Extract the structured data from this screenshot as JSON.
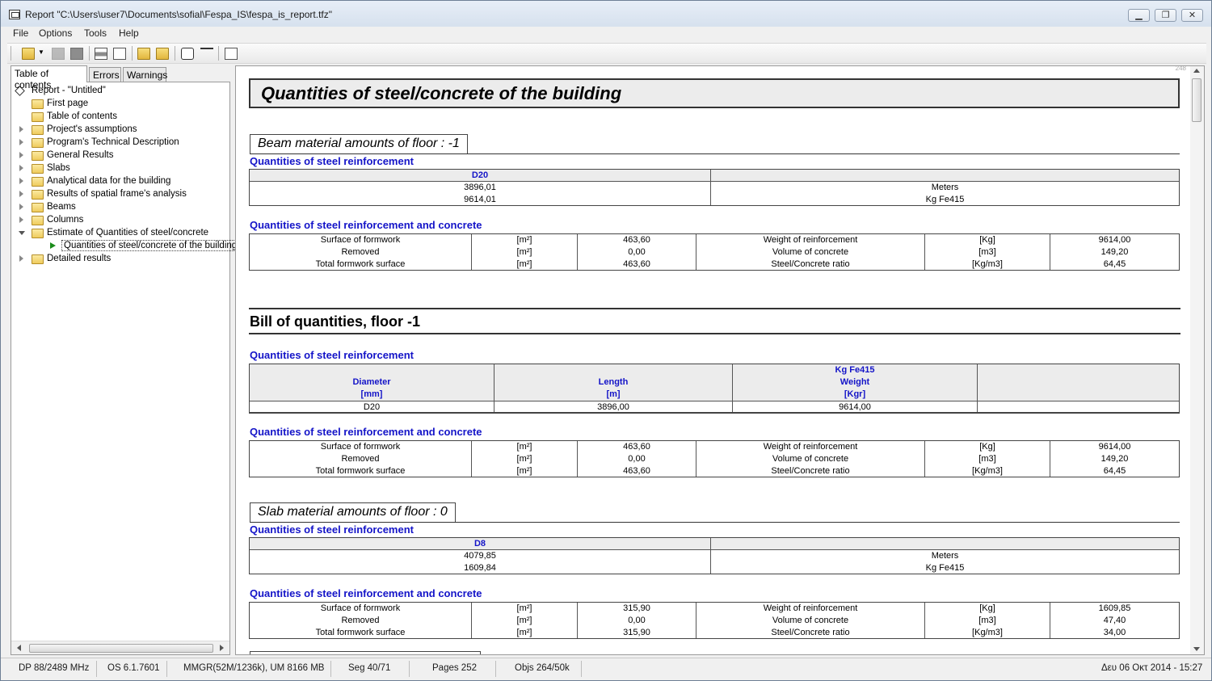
{
  "window": {
    "title": "Report \"C:\\Users\\user7\\Documents\\sofial\\Fespa_IS\\fespa_is_report.tfz\""
  },
  "menu": [
    "File",
    "Options",
    "Tools",
    "Help"
  ],
  "toolbar_icons": [
    "open-folder-icon",
    "dropdown-icon",
    "export-icon",
    "stop-icon",
    "print-icon",
    "print-preview-icon",
    "folder-up-icon",
    "folder-open-icon",
    "find-icon",
    "filter-icon",
    "page-setup-icon"
  ],
  "tabs": [
    "Table of contents",
    "Errors",
    "Warnings"
  ],
  "tree": {
    "root": "Report - \"Untitled\"",
    "items": [
      "First page",
      "Table of contents",
      "Project's assumptions",
      "Program's Technical Description",
      "General Results",
      "Slabs",
      "Analytical data for the building",
      "Results of spatial frame's analysis",
      "Beams",
      "Columns",
      "Estimate of Quantities of steel/concrete",
      "Detailed results"
    ],
    "selected_child": "Quantities of steel/concrete of the building"
  },
  "report": {
    "page_marker": "248",
    "main_heading": "Quantities of steel/concrete of the building",
    "beam_section": {
      "box_title": "Beam material amounts of floor : -1",
      "steel_title": "Quantities of steel reinforcement",
      "steel_header": "D20",
      "steel_values": [
        "3896,01",
        "9614,01"
      ],
      "steel_units": [
        "Meters",
        "Kg Fe415"
      ],
      "concrete_title": "Quantities of steel reinforcement and concrete",
      "concrete_rows": [
        [
          "Surface of formwork",
          "[m²]",
          "463,60",
          "Weight of reinforcement",
          "[Kg]",
          "9614,00"
        ],
        [
          "Removed",
          "[m²]",
          "0,00",
          "Volume of concrete",
          "[m3]",
          "149,20"
        ],
        [
          "Total formwork surface",
          "[m²]",
          "463,60",
          "Steel/Concrete ratio",
          "[Kg/m3]",
          "64,45"
        ]
      ]
    },
    "bill_section": {
      "title": "Bill of quantities, floor -1",
      "steel_title": "Quantities of steel reinforcement",
      "headers": [
        [
          "Diameter",
          "[mm]"
        ],
        [
          "Length",
          "[m]"
        ],
        [
          "Kg Fe415",
          "Weight",
          "[Kgr]"
        ]
      ],
      "row": [
        "D20",
        "3896,00",
        "9614,00"
      ],
      "concrete_title": "Quantities of steel reinforcement and concrete",
      "concrete_rows": [
        [
          "Surface of formwork",
          "[m²]",
          "463,60",
          "Weight of reinforcement",
          "[Kg]",
          "9614,00"
        ],
        [
          "Removed",
          "[m²]",
          "0,00",
          "Volume of concrete",
          "[m3]",
          "149,20"
        ],
        [
          "Total formwork surface",
          "[m²]",
          "463,60",
          "Steel/Concrete ratio",
          "[Kg/m3]",
          "64,45"
        ]
      ]
    },
    "slab_section": {
      "box_title": "Slab material amounts of floor : 0",
      "steel_title": "Quantities of steel reinforcement",
      "steel_header": "D8",
      "steel_values": [
        "4079,85",
        "1609,84"
      ],
      "steel_units": [
        "Meters",
        "Kg Fe415"
      ],
      "concrete_title": "Quantities of steel reinforcement and concrete",
      "concrete_rows": [
        [
          "Surface of formwork",
          "[m²]",
          "315,90",
          "Weight of reinforcement",
          "[Kg]",
          "1609,85"
        ],
        [
          "Removed",
          "[m²]",
          "0,00",
          "Volume of concrete",
          "[m3]",
          "47,40"
        ],
        [
          "Total formwork surface",
          "[m²]",
          "315,90",
          "Steel/Concrete ratio",
          "[Kg/m3]",
          "34,00"
        ]
      ]
    }
  },
  "status": {
    "dp": "DP 88/2489 MHz",
    "os": "OS 6.1.7601",
    "mmgr": "MMGR(52M/1236k), UM 8166 MB",
    "seg": "Seg 40/71",
    "pages": "Pages 252",
    "objs": "Objs 264/50k",
    "datetime": "Δευ 06 Οκτ 2014 - 15:27"
  }
}
